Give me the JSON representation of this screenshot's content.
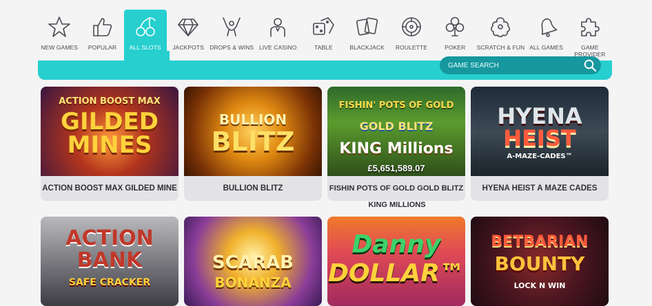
{
  "nav": {
    "items": [
      {
        "label": "NEW GAMES",
        "icon": "star-icon"
      },
      {
        "label": "POPULAR",
        "icon": "thumbs-up-icon"
      },
      {
        "label": "ALL SLOTS",
        "icon": "cherries-icon",
        "active": true
      },
      {
        "label": "JACKPOTS",
        "icon": "diamond-icon"
      },
      {
        "label": "DROPS & WINS",
        "icon": "raised-hands-icon"
      },
      {
        "label": "LIVE CASINO",
        "icon": "dealer-icon"
      },
      {
        "label": "TABLE",
        "icon": "dice-icon"
      },
      {
        "label": "BLACKJACK",
        "icon": "playing-cards-icon"
      },
      {
        "label": "ROULETTE",
        "icon": "roulette-wheel-icon"
      },
      {
        "label": "POKER",
        "icon": "club-suit-icon"
      },
      {
        "label": "SCRATCH & FUN",
        "icon": "scratch-icon"
      },
      {
        "label": "ALL GAMES",
        "icon": "bell-icon"
      },
      {
        "label": "GAME PROVIDER",
        "icon": "puzzle-icon"
      }
    ]
  },
  "search": {
    "placeholder": "GAME SEARCH"
  },
  "games": [
    {
      "title": "ACTION BOOST MAX GILDED MINE",
      "art_line1": "ACTION BOOST MAX",
      "art_line2": "GILDED MINES"
    },
    {
      "title": "BULLION BLITZ",
      "art_line1": "BULLION",
      "art_line2": "BLITZ"
    },
    {
      "title": "FISHIN POTS OF GOLD GOLD BLITZ",
      "title_line2": "KING MILLIONS",
      "art_line1": "FISHIN' POTS OF GOLD",
      "art_line2": "GOLD BLITZ",
      "art_line3": "KING Millions",
      "jackpot": "£5,651,589.07"
    },
    {
      "title": "HYENA HEIST A MAZE CADES",
      "art_line1": "HYENA",
      "art_line2": "HEIST",
      "art_line3": "A-MAZE-CADES™"
    },
    {
      "art_line1": "ACTION",
      "art_line2": "BANK",
      "art_line3": "SAFE CRACKER"
    },
    {
      "art_line1": "SCARAB",
      "art_line2": "BONANZA"
    },
    {
      "art_line1": "Danny",
      "art_line2": "DOLLAR™"
    },
    {
      "art_line1": "BETBARIAN",
      "art_line2": "BOUNTY",
      "art_line3": "LOCK N WIN"
    }
  ],
  "colors": {
    "accent": "#27cfcf",
    "search_bg": "#17979e",
    "text": "#2f2f36"
  }
}
